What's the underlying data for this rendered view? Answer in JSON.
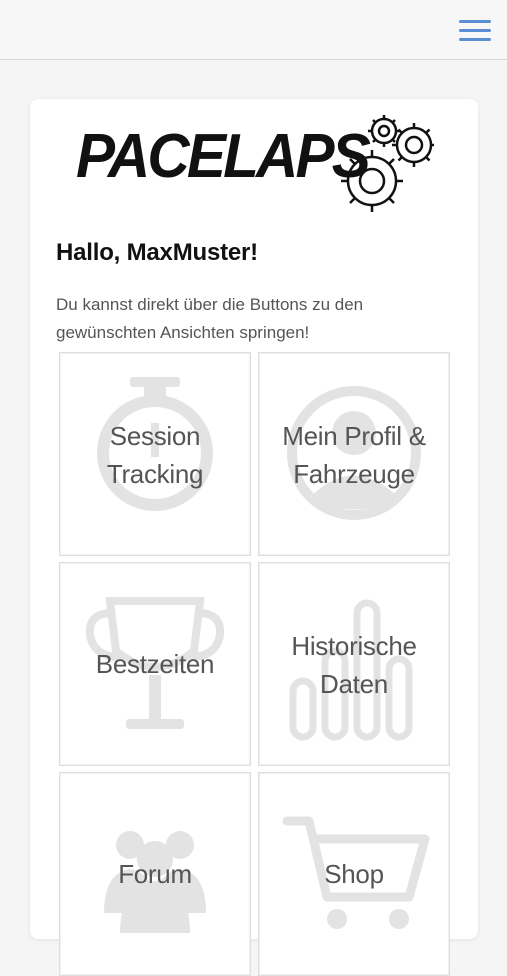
{
  "header": {
    "menu_icon": "hamburger-menu-icon",
    "accent_color": "#5a8fd6"
  },
  "brand": {
    "logo_text": "PACELAPS",
    "logo_icon": "gears-icon"
  },
  "main": {
    "greeting": "Hallo, MaxMuster!",
    "intro": "Du kannst direkt über die Buttons zu den gewünschten Ansichten springen!"
  },
  "tiles": [
    {
      "line1": "Session",
      "line2": "Tracking",
      "icon": "stopwatch-icon"
    },
    {
      "line1": "Mein Profil &",
      "line2": "Fahrzeuge",
      "icon": "user-profile-icon"
    },
    {
      "line1": "Bestzeiten",
      "icon": "trophy-icon"
    },
    {
      "line1": "Historische",
      "line2": "Daten",
      "icon": "bar-chart-icon"
    },
    {
      "line1": "Forum",
      "icon": "users-group-icon"
    },
    {
      "line1": "Shop",
      "icon": "shopping-cart-icon"
    }
  ]
}
